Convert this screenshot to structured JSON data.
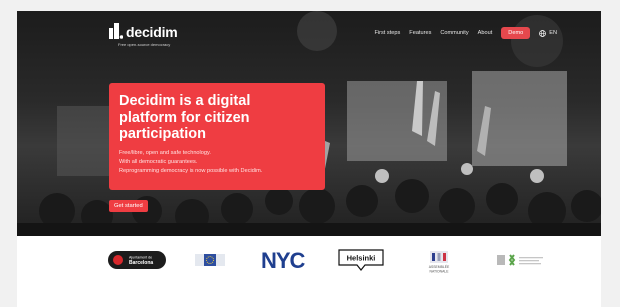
{
  "brand": {
    "name": "decidim",
    "tagline": "Free open-source democracy"
  },
  "nav": {
    "items": [
      "First steps",
      "Features",
      "Community",
      "About"
    ],
    "demo_label": "Demo",
    "language": "EN"
  },
  "hero": {
    "title": "Decidim is a digital platform for citizen participation",
    "lines": [
      "Free/libre, open and safe technology.",
      "With all democratic guarantees.",
      "Reprogramming democracy is now possible with Decidim."
    ],
    "cta_label": "Get started"
  },
  "partners": {
    "barcelona": {
      "line1": "Ajuntament de",
      "line2": "Barcelona"
    },
    "nyc": "NYC",
    "helsinki": "Helsinki",
    "assemblee": {
      "line1": "ASSEMBLÉE",
      "line2": "NATIONALE"
    }
  },
  "colors": {
    "accent": "#ef3d42",
    "dark": "#1f1f1f"
  }
}
